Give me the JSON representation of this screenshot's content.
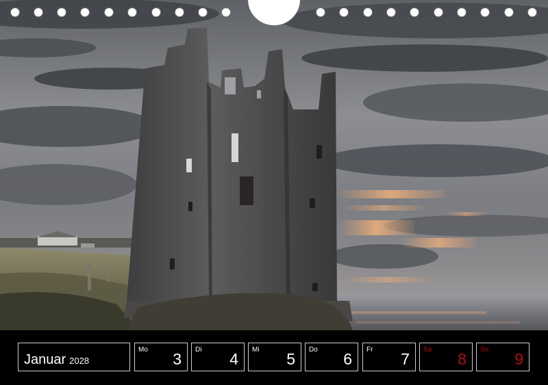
{
  "calendar": {
    "month": "Januar",
    "year": "2028",
    "days": [
      {
        "name": "Mo",
        "number": "3",
        "weekend": false
      },
      {
        "name": "Di",
        "number": "4",
        "weekend": false
      },
      {
        "name": "Mi",
        "number": "5",
        "weekend": false
      },
      {
        "name": "Do",
        "number": "6",
        "weekend": false
      },
      {
        "name": "Fr",
        "number": "7",
        "weekend": false
      },
      {
        "name": "Sa",
        "number": "8",
        "weekend": true
      },
      {
        "name": "So",
        "number": "9",
        "weekend": true
      }
    ]
  },
  "colors": {
    "background": "#000000",
    "weekend": "#b00c0c",
    "sunset": "#e9a46c",
    "stone": "#5b5b5b"
  }
}
